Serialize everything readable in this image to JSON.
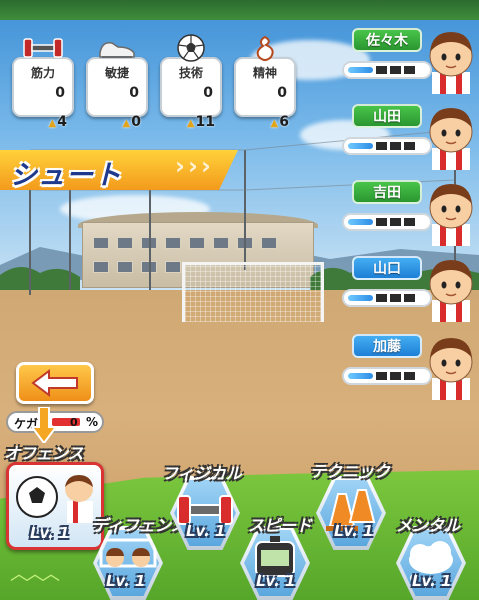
{
  "stats": [
    {
      "id": "power",
      "label": "筋力",
      "value": "0",
      "bonus": "4",
      "icon": "dumbbell-icon"
    },
    {
      "id": "agility",
      "label": "敏捷",
      "value": "0",
      "bonus": "0",
      "icon": "shoe-icon"
    },
    {
      "id": "technique",
      "label": "技術",
      "value": "0",
      "bonus": "11",
      "icon": "soccer-ball-icon"
    },
    {
      "id": "mental",
      "label": "精神",
      "value": "0",
      "bonus": "6",
      "icon": "spirit-icon"
    }
  ],
  "bonus_marker": "▲",
  "banner": {
    "title": "シュート"
  },
  "players": [
    {
      "name": "佐々木",
      "tag_color": "green",
      "gauge_fill": 0.3
    },
    {
      "name": "山田",
      "tag_color": "green",
      "gauge_fill": 0.3
    },
    {
      "name": "吉田",
      "tag_color": "green",
      "gauge_fill": 0.3
    },
    {
      "name": "山口",
      "tag_color": "blue",
      "gauge_fill": 0.3
    },
    {
      "name": "加藤",
      "tag_color": "blue",
      "gauge_fill": 0.3
    }
  ],
  "injury": {
    "label": "ケガ",
    "value": "0",
    "unit": "%"
  },
  "training": {
    "offense": {
      "label": "オフェンス",
      "level": "Lv. 1"
    },
    "defense": {
      "label": "ディフェンス",
      "level": "Lv. 1"
    },
    "physical": {
      "label": "フィジカル",
      "level": "Lv. 1"
    },
    "speed": {
      "label": "スピード",
      "level": "Lv. 1"
    },
    "technic": {
      "label": "テクニック",
      "level": "Lv. 1"
    },
    "mental": {
      "label": "メンタル",
      "level": "Lv. 1"
    }
  },
  "colors": {
    "accent_orange": "#f39a1c",
    "tag_green": "#2a9630",
    "tag_blue": "#1d7fd6",
    "offense_border": "#d83434"
  }
}
